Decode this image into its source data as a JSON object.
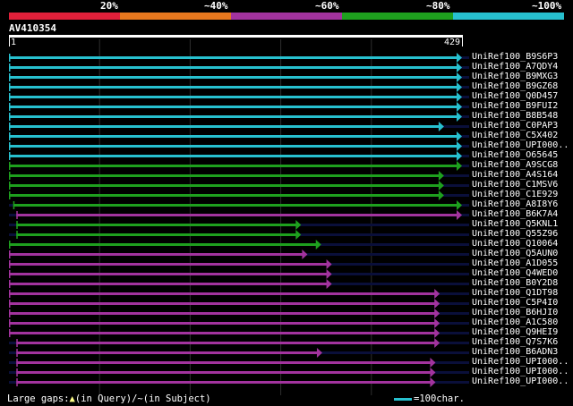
{
  "header": {
    "percent_labels": [
      "20%",
      "~40%",
      "~60%",
      "~80%",
      "~100%"
    ],
    "color_bands": [
      "#e0203a",
      "#e8781e",
      "#a2339e",
      "#1ea01e",
      "#27c0cf"
    ]
  },
  "query": {
    "id": "AV410354",
    "start": "1",
    "end": "429"
  },
  "colors": {
    "cyan": "#27c0cf",
    "green": "#1ea01e",
    "purple": "#a2339e",
    "track": "#0a0f3a",
    "grid": "#2e2e2e",
    "gap_line": "#000000",
    "subject_gap_marker": "#ffff88"
  },
  "hits": [
    {
      "name": "UniRef100_B9S6P3",
      "color": "cyan",
      "qs": 1,
      "qe": 429
    },
    {
      "name": "UniRef100_A7QDY4",
      "color": "cyan",
      "qs": 1,
      "qe": 429
    },
    {
      "name": "UniRef100_B9MXG3",
      "color": "cyan",
      "qs": 1,
      "qe": 429
    },
    {
      "name": "UniRef100_B9GZ68",
      "color": "cyan",
      "qs": 1,
      "qe": 429
    },
    {
      "name": "UniRef100_Q0D457",
      "color": "cyan",
      "qs": 1,
      "qe": 429
    },
    {
      "name": "UniRef100_B9FUI2",
      "color": "cyan",
      "qs": 1,
      "qe": 429
    },
    {
      "name": "UniRef100_B8B548",
      "color": "cyan",
      "qs": 1,
      "qe": 429
    },
    {
      "name": "UniRef100_C0PAP3",
      "color": "cyan",
      "qs": 1,
      "qe": 412
    },
    {
      "name": "UniRef100_C5X402",
      "color": "cyan",
      "qs": 1,
      "qe": 429
    },
    {
      "name": "UniRef100_UPI000..",
      "color": "cyan",
      "qs": 1,
      "qe": 429
    },
    {
      "name": "UniRef100_O65645",
      "color": "cyan",
      "qs": 1,
      "qe": 429
    },
    {
      "name": "UniRef100_A9SCG8",
      "color": "green",
      "qs": 1,
      "qe": 429
    },
    {
      "name": "UniRef100_A4S164",
      "color": "green",
      "qs": 1,
      "qe": 412
    },
    {
      "name": "UniRef100_C1MSV6",
      "color": "green",
      "qs": 1,
      "qe": 412
    },
    {
      "name": "UniRef100_C1E929",
      "color": "green",
      "qs": 1,
      "qe": 412
    },
    {
      "name": "UniRef100_A8I8Y6",
      "color": "green",
      "qs": 5,
      "qe": 429
    },
    {
      "name": "UniRef100_B6K7A4",
      "color": "purple",
      "qs": 8,
      "qe": 429
    },
    {
      "name": "UniRef100_Q5KNL1",
      "color": "green",
      "qs": 8,
      "qe": 277
    },
    {
      "name": "UniRef100_Q55Z96",
      "color": "green",
      "qs": 8,
      "qe": 277
    },
    {
      "name": "UniRef100_Q10064",
      "color": "green",
      "qs": 1,
      "qe": 296
    },
    {
      "name": "UniRef100_Q5AUN0",
      "color": "purple",
      "qs": 1,
      "qe": 283
    },
    {
      "name": "UniRef100_A1D055",
      "color": "purple",
      "qs": 1,
      "qe": 306
    },
    {
      "name": "UniRef100_Q4WED0",
      "color": "purple",
      "qs": 1,
      "qe": 306
    },
    {
      "name": "UniRef100_B0Y2D8",
      "color": "purple",
      "qs": 1,
      "qe": 306
    },
    {
      "name": "UniRef100_Q1DT98",
      "color": "purple",
      "qs": 1,
      "qe": 408
    },
    {
      "name": "UniRef100_C5P4I0",
      "color": "purple",
      "qs": 1,
      "qe": 408
    },
    {
      "name": "UniRef100_B6HJI0",
      "color": "purple",
      "qs": 1,
      "qe": 408
    },
    {
      "name": "UniRef100_A1C580",
      "color": "purple",
      "qs": 1,
      "qe": 408
    },
    {
      "name": "UniRef100_Q9HEI9",
      "color": "purple",
      "qs": 1,
      "qe": 408
    },
    {
      "name": "UniRef100_Q7S7K6",
      "color": "purple",
      "qs": 8,
      "qe": 408
    },
    {
      "name": "UniRef100_B6ADN3",
      "color": "purple",
      "qs": 8,
      "qe": 297
    },
    {
      "name": "UniRef100_UPI000..",
      "color": "purple",
      "qs": 8,
      "qe": 404
    },
    {
      "name": "UniRef100_UPI000..",
      "color": "purple",
      "qs": 8,
      "qe": 404
    },
    {
      "name": "UniRef100_UPI000..",
      "color": "purple",
      "qs": 8,
      "qe": 404
    }
  ],
  "footer": {
    "large_gaps_prefix": "Large gaps:",
    "query_gap_text": "(in Query)/",
    "subject_gap_text": "(in Subject)",
    "scale_text": "=100char."
  }
}
